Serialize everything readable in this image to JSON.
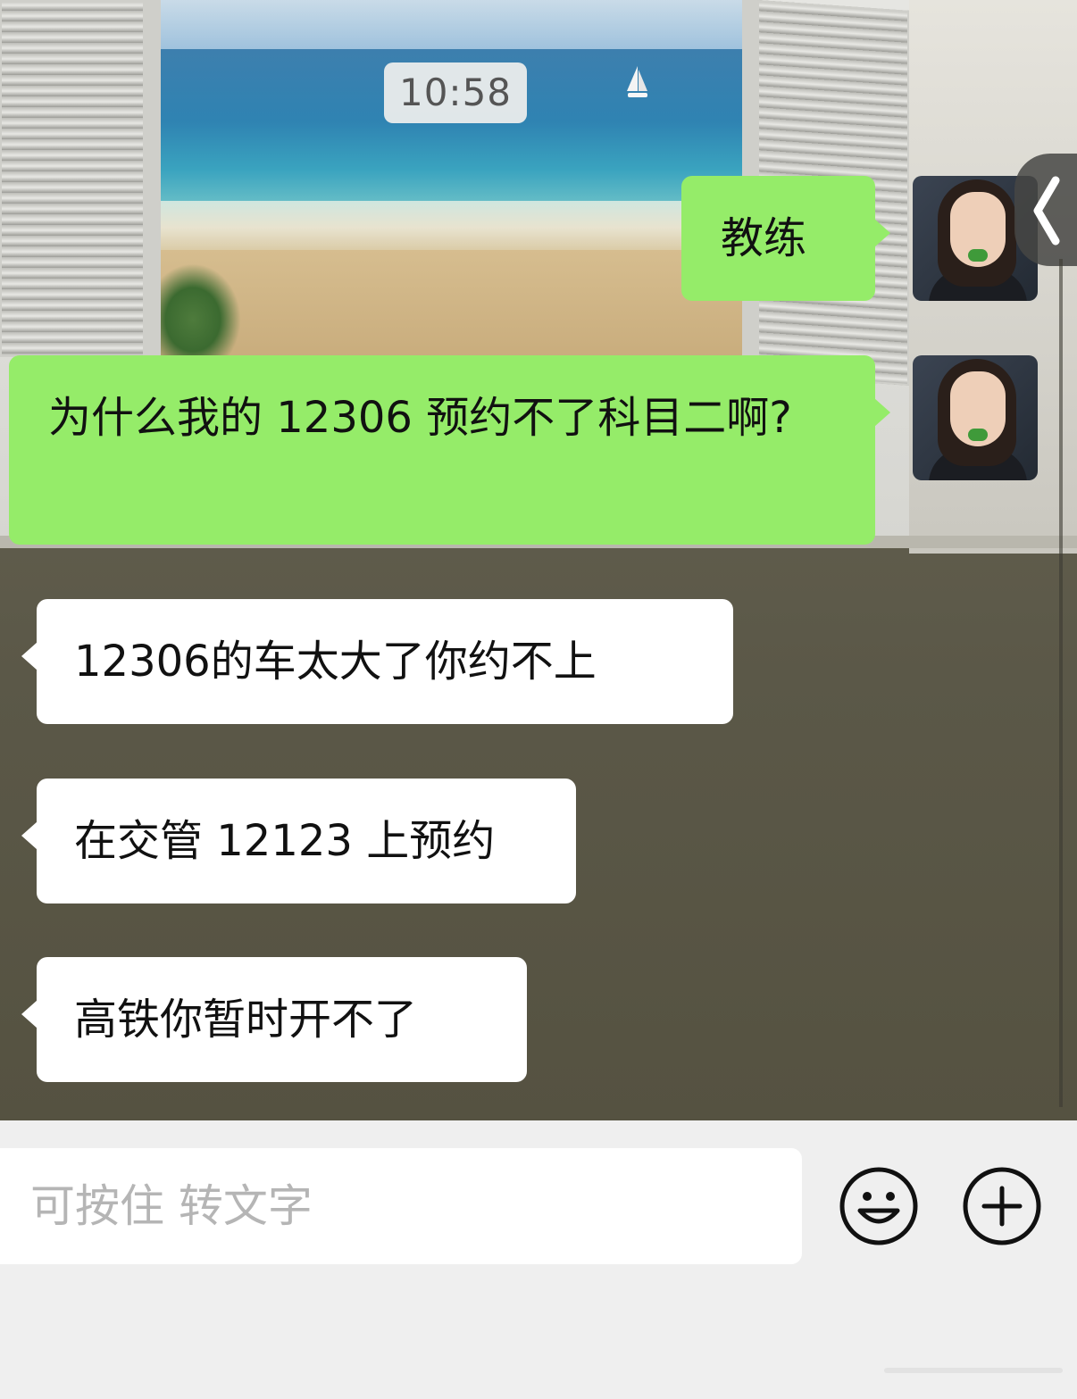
{
  "chat": {
    "timestamp": "10:58",
    "messages": [
      {
        "side": "sent",
        "text": "教练"
      },
      {
        "side": "sent",
        "text": "为什么我的 12306 预约不了科目二啊?"
      },
      {
        "side": "received",
        "text": "12306的车太大了你约不上"
      },
      {
        "side": "received",
        "text": "在交管 12123 上预约"
      },
      {
        "side": "received",
        "text": "高铁你暂时开不了"
      }
    ]
  },
  "input_bar": {
    "voice_hint": "可按住 转文字",
    "emoji_icon": "smiley-face-icon",
    "plus_icon": "plus-circle-icon"
  },
  "colors": {
    "sent_bubble": "#95ec69",
    "received_bubble": "#ffffff",
    "input_bar_bg": "#efefef"
  }
}
